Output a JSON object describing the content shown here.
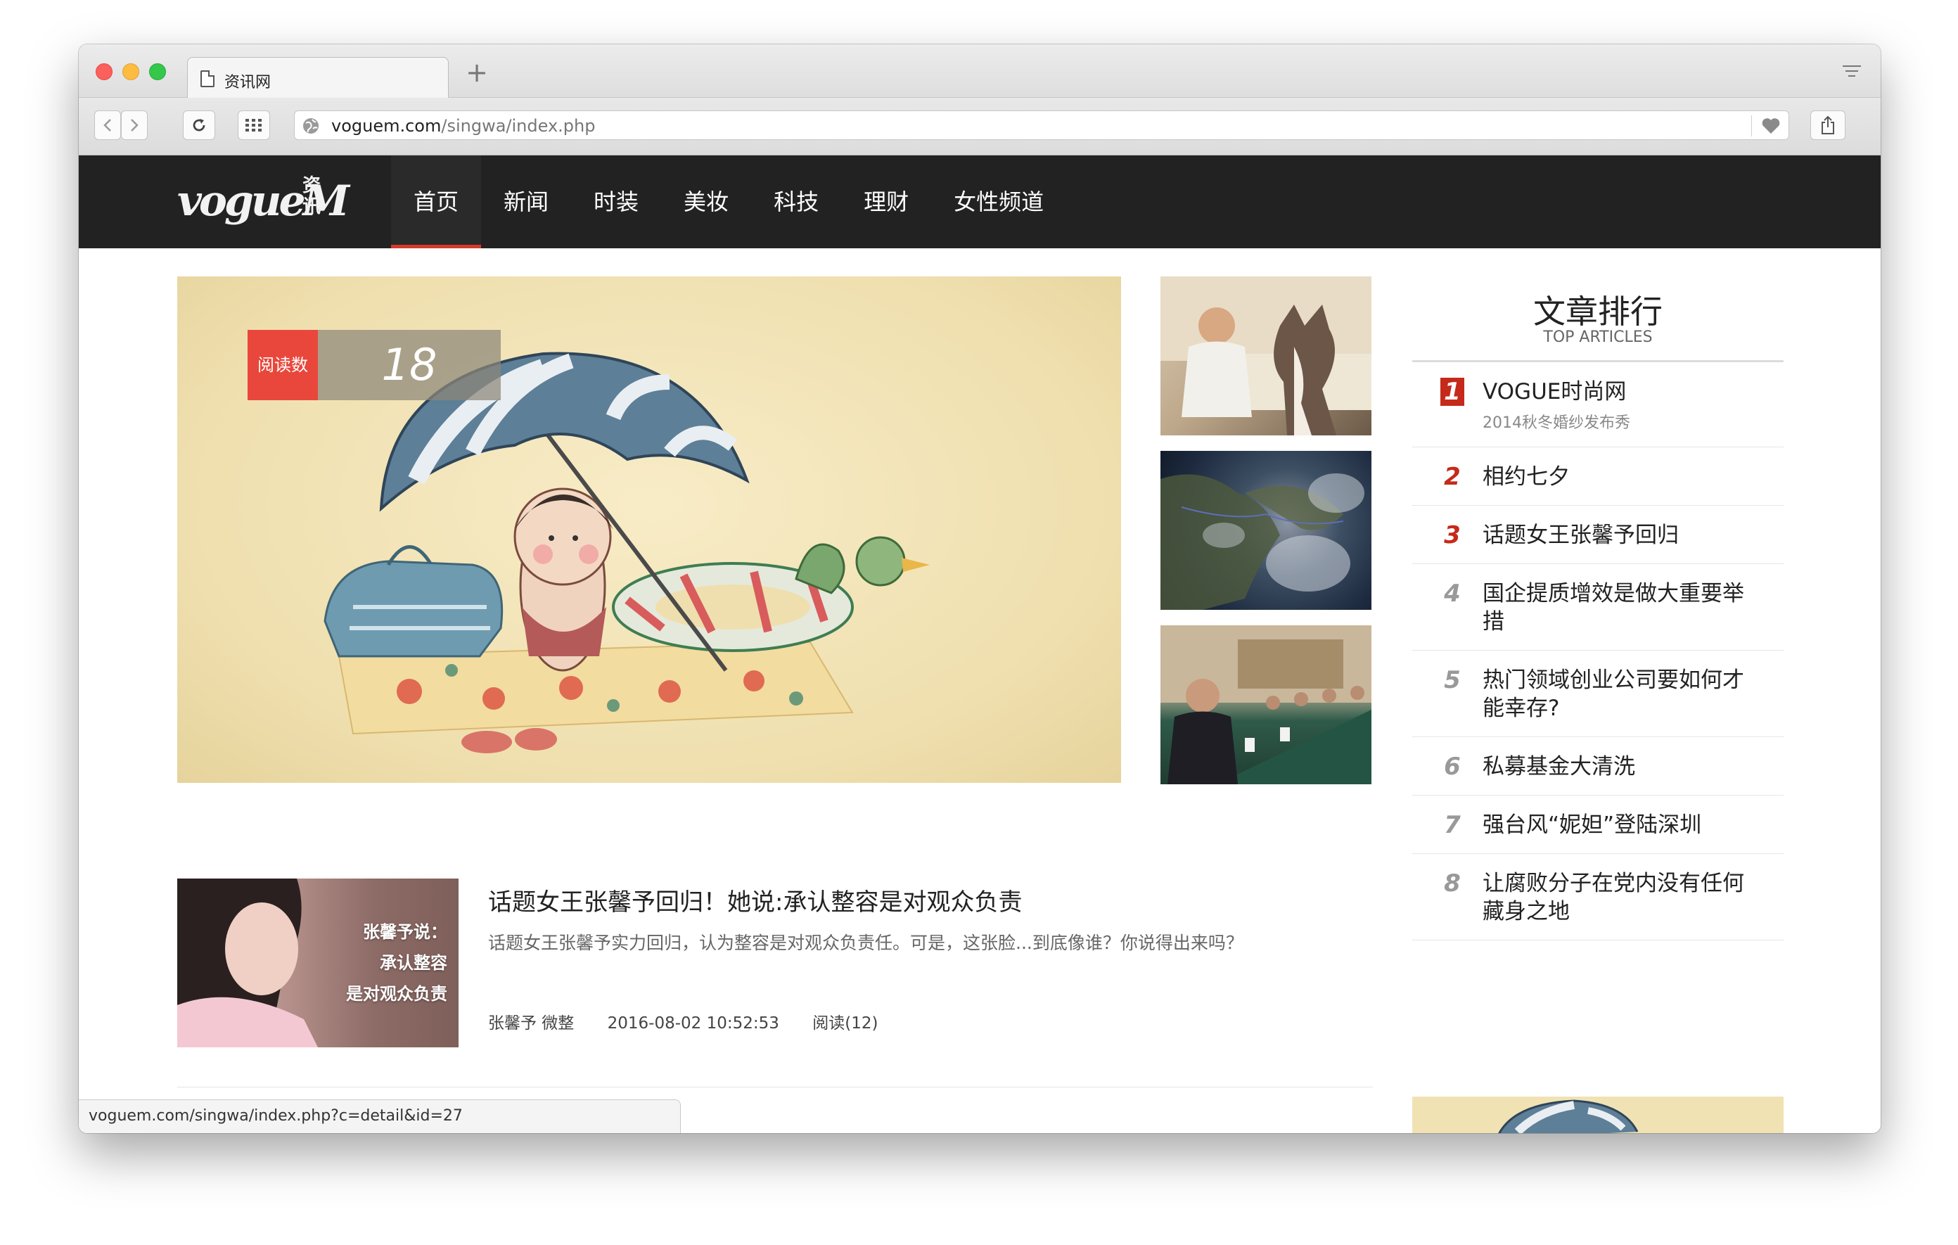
{
  "browser": {
    "tab_title": "资讯网",
    "new_tab_label": "+",
    "url_host": "voguem.com",
    "url_path": "/singwa/index.php",
    "status_url": "voguem.com/singwa/index.php?c=detail&id=27"
  },
  "site": {
    "logo_text": "vogueM",
    "logo_sub": "资讯",
    "nav": [
      {
        "label": "首页",
        "active": true
      },
      {
        "label": "新闻"
      },
      {
        "label": "时装"
      },
      {
        "label": "美妆"
      },
      {
        "label": "科技"
      },
      {
        "label": "理财"
      },
      {
        "label": "女性频道"
      }
    ]
  },
  "hero": {
    "read_label": "阅读数",
    "read_count": "18"
  },
  "article": {
    "title": "话题女王张馨予回归！她说:承认整容是对观众负责",
    "summary": "话题女王张馨予实力回归，认为整容是对观众负责任。可是，这张脸...到底像谁？你说得出来吗？",
    "author": "张馨予 微整",
    "date": "2016-08-02 10:52:53",
    "views": "阅读(12)",
    "image_text": [
      "张馨予说：",
      "承认整容",
      "是对观众负责"
    ]
  },
  "sidebar": {
    "title": "文章排行",
    "subtitle": "TOP ARTICLES",
    "items": [
      {
        "rank": "1",
        "title": "VOGUE时尚网",
        "sub": "2014秋冬婚纱发布秀"
      },
      {
        "rank": "2",
        "title": "相约七夕"
      },
      {
        "rank": "3",
        "title": "话题女王张馨予回归"
      },
      {
        "rank": "4",
        "title": "国企提质增效是做大重要举措"
      },
      {
        "rank": "5",
        "title": "热门领域创业公司要如何才能幸存?"
      },
      {
        "rank": "6",
        "title": "私募基金大清洗"
      },
      {
        "rank": "7",
        "title": "强台风“妮妲”登陆深圳"
      },
      {
        "rank": "8",
        "title": "让腐败分子在党内没有任何藏身之地"
      }
    ]
  },
  "colors": {
    "nav_bg": "#222222",
    "accent_red": "#c52a1a",
    "badge_red": "#e9473b"
  }
}
